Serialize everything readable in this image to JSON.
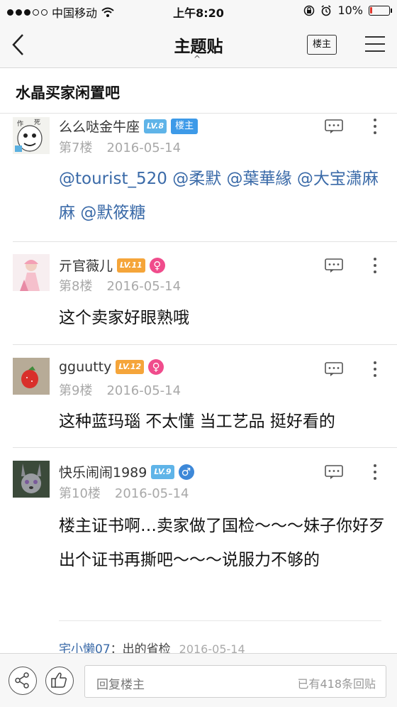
{
  "status_bar": {
    "carrier": "中国移动",
    "time": "上午8:20",
    "battery": "10%",
    "battery_level": 0.1
  },
  "nav": {
    "title": "主题贴",
    "owner_button": "楼主",
    "icons": [
      "back-chevron-icon",
      "caret-up-icon",
      "hamburger-menu-icon"
    ]
  },
  "forum": {
    "name": "水晶买家闲置吧"
  },
  "posts": [
    {
      "username": "么么哒金牛座",
      "level": "LV.8",
      "owner_tag": "楼主",
      "floor": "第7楼",
      "date": "2016-05-14",
      "content_mentions": [
        "@tourist_520",
        "@柔默",
        "@葉華緣",
        "@大宝潇麻麻",
        "@默筱糖"
      ]
    },
    {
      "username": "亓官薇儿",
      "level": "LV.11",
      "gender": "♀",
      "floor": "第8楼",
      "date": "2016-05-14",
      "content": "这个卖家好眼熟哦"
    },
    {
      "username": "gguutty",
      "level": "LV.12",
      "gender": "♀",
      "floor": "第9楼",
      "date": "2016-05-14",
      "content": "这种蓝玛瑙 不太懂 当工艺品 挺好看的"
    },
    {
      "username": "快乐闹闹1989",
      "level": "LV.9",
      "gender": "♂",
      "floor": "第10楼",
      "date": "2016-05-14",
      "content": "楼主证书啊…卖家做了国检～～～妹子你好歹出个证书再撕吧～～～说服力不够的",
      "sub_reply": {
        "user": "宅小懒07",
        "sep": "：",
        "text": "出的省检",
        "date": "2016-05-14"
      }
    }
  ],
  "bottom": {
    "placeholder": "回复楼主",
    "reply_count": "已有418条回贴",
    "icons": [
      "share-icon",
      "thumbs-up-icon"
    ]
  },
  "colors": {
    "accent_blue": "#3d9ae8",
    "mention": "#3a6aa8",
    "level_blue": "#5fb4e8",
    "level_orange": "#f5a53a",
    "female": "#f04c8c",
    "male": "#3d88d8"
  }
}
